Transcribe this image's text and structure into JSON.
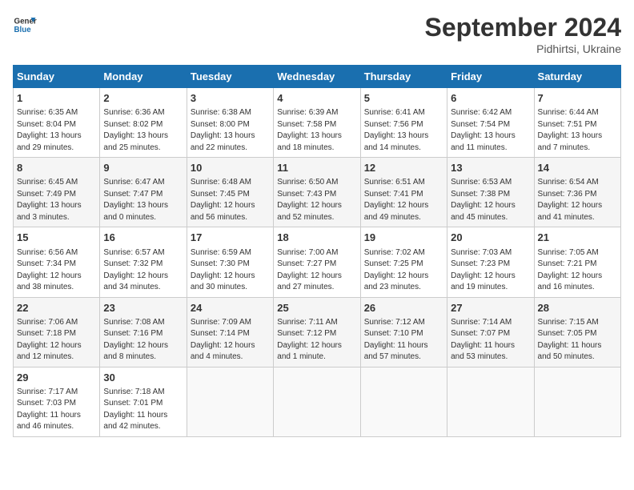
{
  "logo": {
    "line1": "General",
    "line2": "Blue"
  },
  "title": "September 2024",
  "subtitle": "Pidhirtsi, Ukraine",
  "weekdays": [
    "Sunday",
    "Monday",
    "Tuesday",
    "Wednesday",
    "Thursday",
    "Friday",
    "Saturday"
  ],
  "weeks": [
    [
      {
        "day": "1",
        "info": "Sunrise: 6:35 AM\nSunset: 8:04 PM\nDaylight: 13 hours\nand 29 minutes."
      },
      {
        "day": "2",
        "info": "Sunrise: 6:36 AM\nSunset: 8:02 PM\nDaylight: 13 hours\nand 25 minutes."
      },
      {
        "day": "3",
        "info": "Sunrise: 6:38 AM\nSunset: 8:00 PM\nDaylight: 13 hours\nand 22 minutes."
      },
      {
        "day": "4",
        "info": "Sunrise: 6:39 AM\nSunset: 7:58 PM\nDaylight: 13 hours\nand 18 minutes."
      },
      {
        "day": "5",
        "info": "Sunrise: 6:41 AM\nSunset: 7:56 PM\nDaylight: 13 hours\nand 14 minutes."
      },
      {
        "day": "6",
        "info": "Sunrise: 6:42 AM\nSunset: 7:54 PM\nDaylight: 13 hours\nand 11 minutes."
      },
      {
        "day": "7",
        "info": "Sunrise: 6:44 AM\nSunset: 7:51 PM\nDaylight: 13 hours\nand 7 minutes."
      }
    ],
    [
      {
        "day": "8",
        "info": "Sunrise: 6:45 AM\nSunset: 7:49 PM\nDaylight: 13 hours\nand 3 minutes."
      },
      {
        "day": "9",
        "info": "Sunrise: 6:47 AM\nSunset: 7:47 PM\nDaylight: 13 hours\nand 0 minutes."
      },
      {
        "day": "10",
        "info": "Sunrise: 6:48 AM\nSunset: 7:45 PM\nDaylight: 12 hours\nand 56 minutes."
      },
      {
        "day": "11",
        "info": "Sunrise: 6:50 AM\nSunset: 7:43 PM\nDaylight: 12 hours\nand 52 minutes."
      },
      {
        "day": "12",
        "info": "Sunrise: 6:51 AM\nSunset: 7:41 PM\nDaylight: 12 hours\nand 49 minutes."
      },
      {
        "day": "13",
        "info": "Sunrise: 6:53 AM\nSunset: 7:38 PM\nDaylight: 12 hours\nand 45 minutes."
      },
      {
        "day": "14",
        "info": "Sunrise: 6:54 AM\nSunset: 7:36 PM\nDaylight: 12 hours\nand 41 minutes."
      }
    ],
    [
      {
        "day": "15",
        "info": "Sunrise: 6:56 AM\nSunset: 7:34 PM\nDaylight: 12 hours\nand 38 minutes."
      },
      {
        "day": "16",
        "info": "Sunrise: 6:57 AM\nSunset: 7:32 PM\nDaylight: 12 hours\nand 34 minutes."
      },
      {
        "day": "17",
        "info": "Sunrise: 6:59 AM\nSunset: 7:30 PM\nDaylight: 12 hours\nand 30 minutes."
      },
      {
        "day": "18",
        "info": "Sunrise: 7:00 AM\nSunset: 7:27 PM\nDaylight: 12 hours\nand 27 minutes."
      },
      {
        "day": "19",
        "info": "Sunrise: 7:02 AM\nSunset: 7:25 PM\nDaylight: 12 hours\nand 23 minutes."
      },
      {
        "day": "20",
        "info": "Sunrise: 7:03 AM\nSunset: 7:23 PM\nDaylight: 12 hours\nand 19 minutes."
      },
      {
        "day": "21",
        "info": "Sunrise: 7:05 AM\nSunset: 7:21 PM\nDaylight: 12 hours\nand 16 minutes."
      }
    ],
    [
      {
        "day": "22",
        "info": "Sunrise: 7:06 AM\nSunset: 7:18 PM\nDaylight: 12 hours\nand 12 minutes."
      },
      {
        "day": "23",
        "info": "Sunrise: 7:08 AM\nSunset: 7:16 PM\nDaylight: 12 hours\nand 8 minutes."
      },
      {
        "day": "24",
        "info": "Sunrise: 7:09 AM\nSunset: 7:14 PM\nDaylight: 12 hours\nand 4 minutes."
      },
      {
        "day": "25",
        "info": "Sunrise: 7:11 AM\nSunset: 7:12 PM\nDaylight: 12 hours\nand 1 minute."
      },
      {
        "day": "26",
        "info": "Sunrise: 7:12 AM\nSunset: 7:10 PM\nDaylight: 11 hours\nand 57 minutes."
      },
      {
        "day": "27",
        "info": "Sunrise: 7:14 AM\nSunset: 7:07 PM\nDaylight: 11 hours\nand 53 minutes."
      },
      {
        "day": "28",
        "info": "Sunrise: 7:15 AM\nSunset: 7:05 PM\nDaylight: 11 hours\nand 50 minutes."
      }
    ],
    [
      {
        "day": "29",
        "info": "Sunrise: 7:17 AM\nSunset: 7:03 PM\nDaylight: 11 hours\nand 46 minutes."
      },
      {
        "day": "30",
        "info": "Sunrise: 7:18 AM\nSunset: 7:01 PM\nDaylight: 11 hours\nand 42 minutes."
      },
      {
        "day": "",
        "info": ""
      },
      {
        "day": "",
        "info": ""
      },
      {
        "day": "",
        "info": ""
      },
      {
        "day": "",
        "info": ""
      },
      {
        "day": "",
        "info": ""
      }
    ]
  ]
}
